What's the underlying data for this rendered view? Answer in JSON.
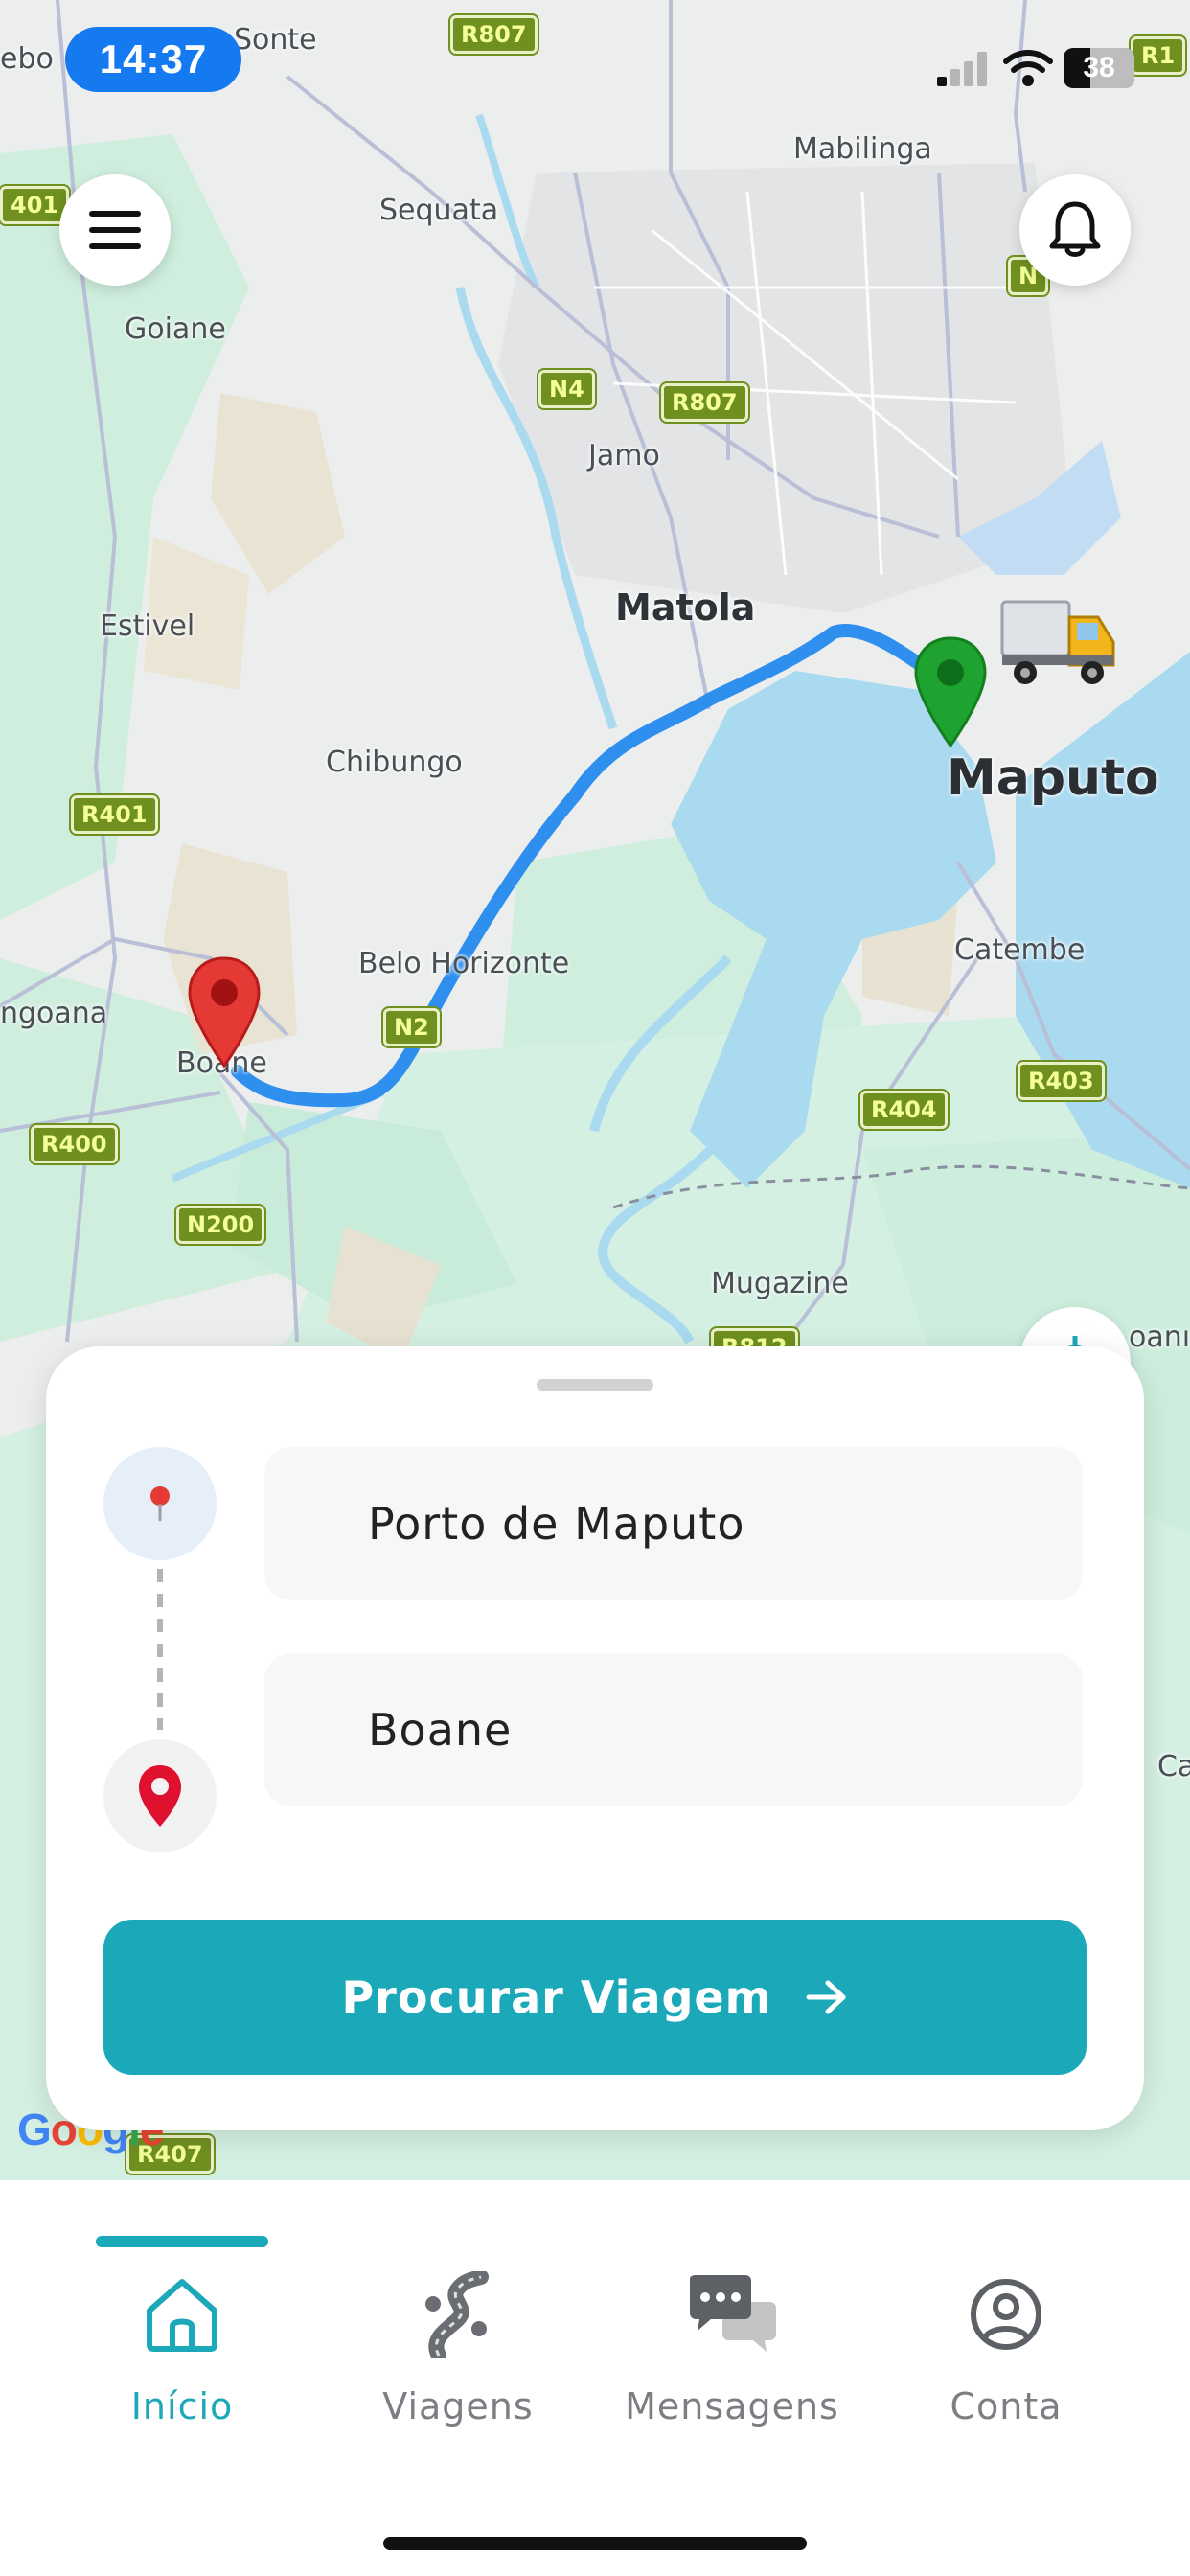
{
  "status": {
    "time": "14:37",
    "battery": "38"
  },
  "map": {
    "places": {
      "mabilinga": "Mabilinga",
      "sequata": "Sequata",
      "goiane": "Goiane",
      "jamo": "Jamo",
      "matola": "Matola",
      "estivel": "Estivel",
      "chibungo": "Chibungo",
      "maputo": "Maputo",
      "catembe": "Catembe",
      "belo_horizonte": "Belo Horizonte",
      "ngoana": "ngoana",
      "boane": "Boane",
      "mugazine": "Mugazine",
      "sonte": "Sonte",
      "ebo": "ebo",
      "oanı": "oanı",
      "ca": "Ca"
    },
    "roads": {
      "n4": "N4",
      "r807": "R807",
      "r401": "R401",
      "n2": "N2",
      "r404": "R404",
      "r403": "R403",
      "r400": "R400",
      "n200": "N200",
      "r401_top": "401",
      "r807_top": "R807",
      "n_right": "N",
      "r1": "R1",
      "r812": "R812",
      "r407": "R407"
    },
    "attribution": "Google"
  },
  "header": {
    "menu_icon": "hamburger-menu-icon",
    "bell_icon": "bell-icon"
  },
  "trip": {
    "origin": "Porto de Maputo",
    "destination": "Boane",
    "search_label": "Procurar Viagem"
  },
  "tabs": [
    {
      "label": "Início",
      "icon": "home-icon",
      "active": true
    },
    {
      "label": "Viagens",
      "icon": "road-icon",
      "active": false
    },
    {
      "label": "Mensagens",
      "icon": "chat-bubbles-icon",
      "active": false
    },
    {
      "label": "Conta",
      "icon": "user-circle-icon",
      "active": false
    }
  ],
  "colors": {
    "accent": "#1ba8b8",
    "route": "#2f8fef",
    "water": "#aadaf0",
    "status_pill": "#1579f0"
  }
}
